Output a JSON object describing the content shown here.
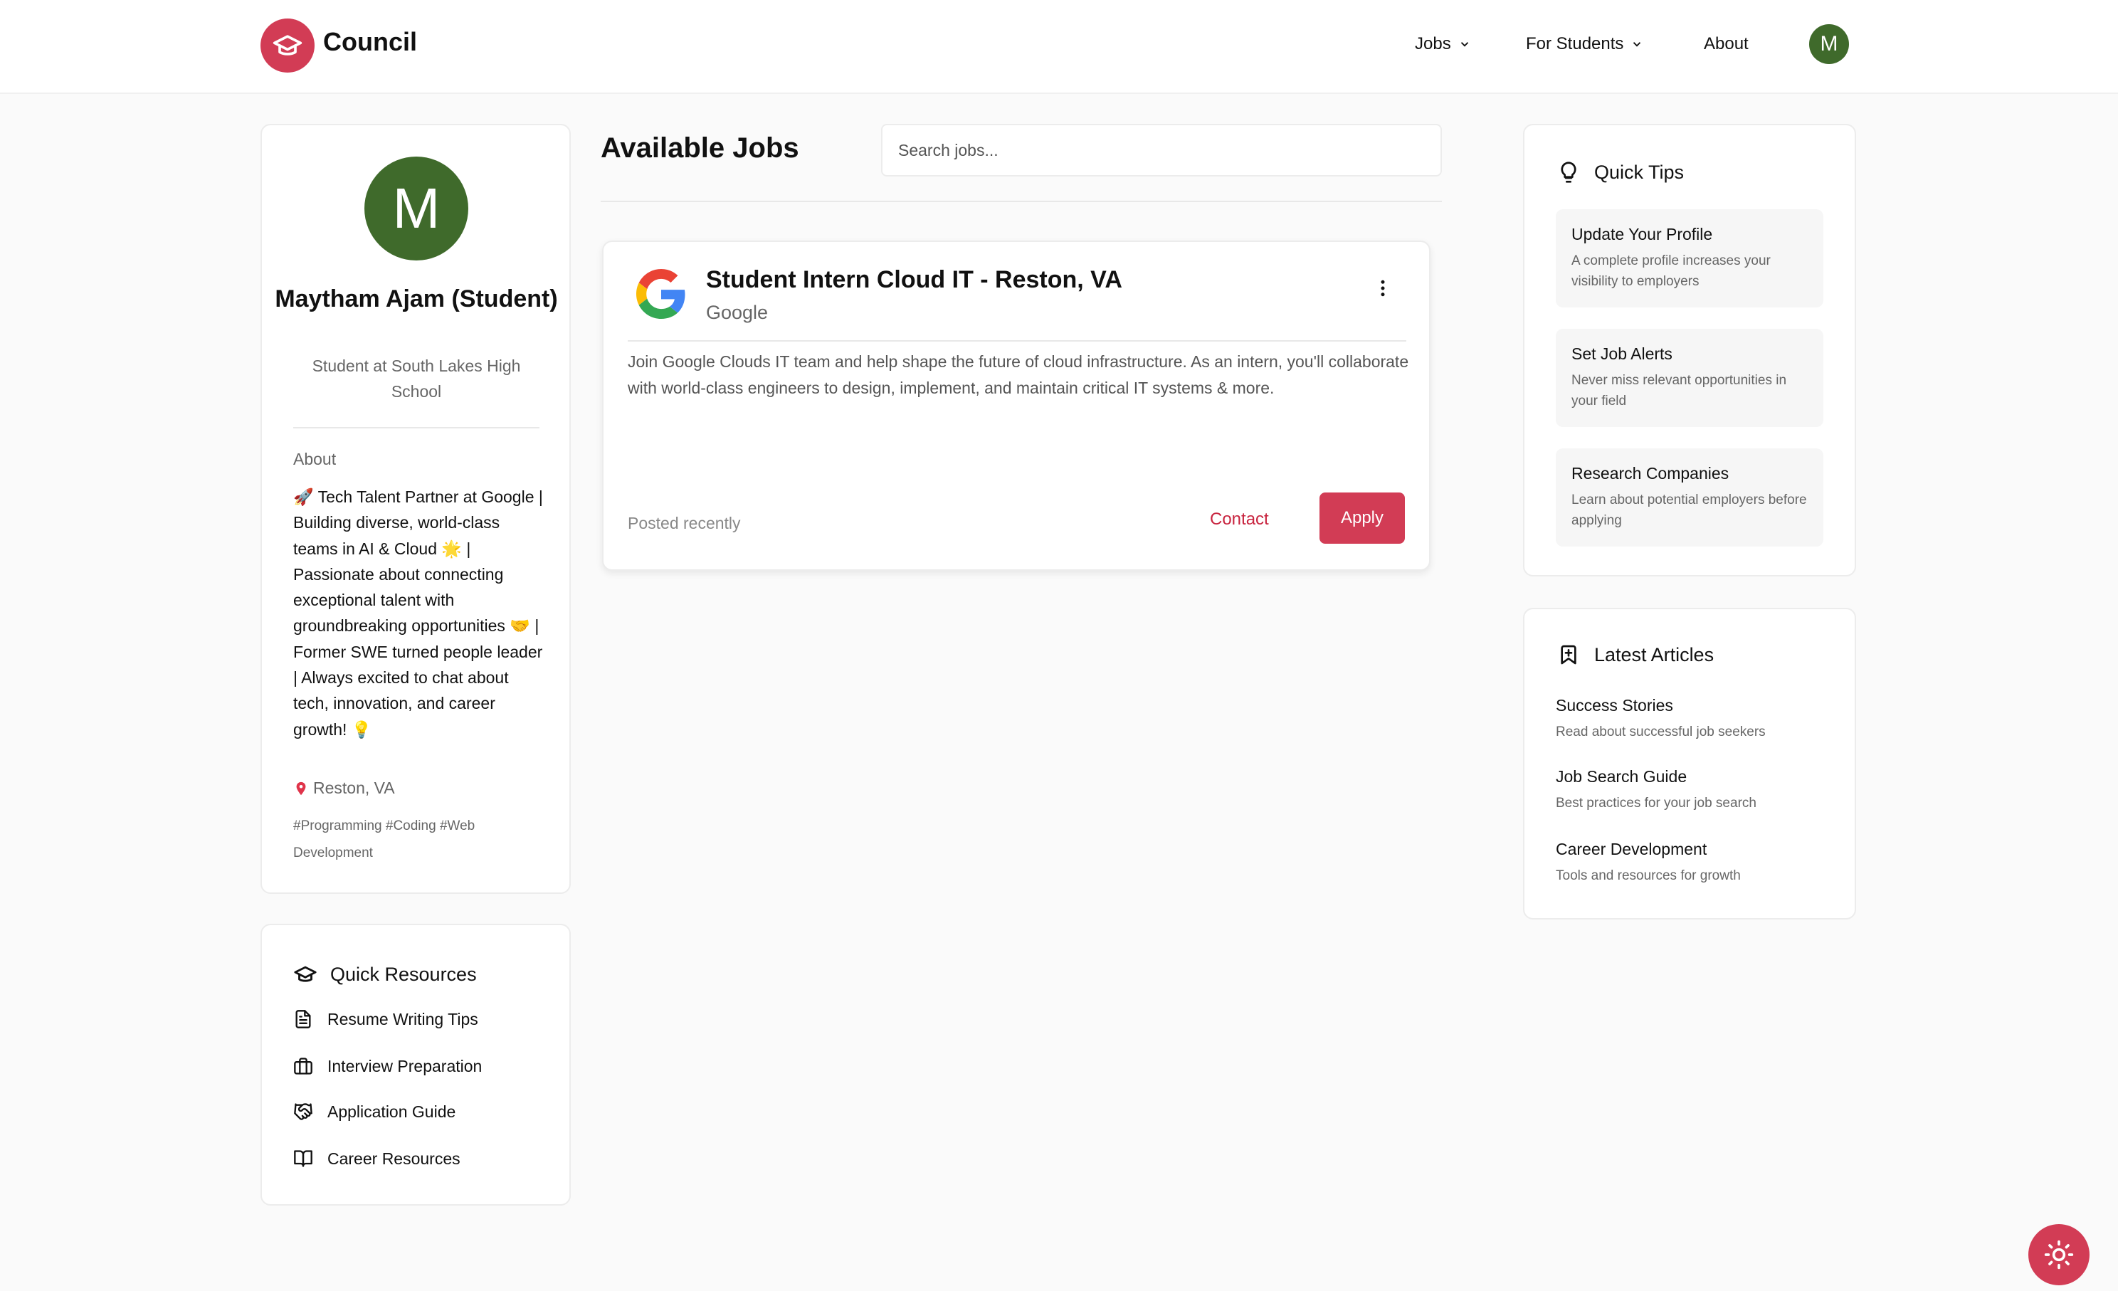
{
  "nav": {
    "brand": "Council",
    "jobs": "Jobs",
    "for_students": "For Students",
    "about": "About",
    "avatar_letter": "M"
  },
  "profile": {
    "avatar_letter": "M",
    "name": "Maytham Ajam (Student)",
    "subtitle": "Student at South Lakes High School",
    "about_label": "About",
    "about_text": "🚀 Tech Talent Partner at Google | Building diverse, world-class teams in AI & Cloud 🌟 | Passionate about connecting exceptional talent with groundbreaking opportunities 🤝 | Former SWE turned people leader | Always excited to chat about tech, innovation, and career growth! 💡",
    "location": "Reston, VA",
    "tags": "#Programming #Coding #Web Development"
  },
  "resources": {
    "title": "Quick Resources",
    "items": [
      {
        "label": "Resume Writing Tips",
        "icon": "document-icon"
      },
      {
        "label": "Interview Preparation",
        "icon": "briefcase-icon"
      },
      {
        "label": "Application Guide",
        "icon": "handshake-icon"
      },
      {
        "label": "Career Resources",
        "icon": "book-icon"
      }
    ]
  },
  "main": {
    "title": "Available Jobs",
    "search_placeholder": "Search jobs..."
  },
  "job": {
    "title": "Student Intern Cloud IT - Reston, VA",
    "company": "Google",
    "description": "Join Google Clouds IT team and help shape the future of cloud infrastructure. As an intern, you'll collaborate with world-class engineers to design, implement, and maintain critical IT systems & more.",
    "posted": "Posted recently",
    "contact_label": "Contact",
    "apply_label": "Apply"
  },
  "tips": {
    "title": "Quick Tips",
    "items": [
      {
        "title": "Update Your Profile",
        "desc": "A complete profile increases your visibility to employers"
      },
      {
        "title": "Set Job Alerts",
        "desc": "Never miss relevant opportunities in your field"
      },
      {
        "title": "Research Companies",
        "desc": "Learn about potential employers before applying"
      }
    ]
  },
  "articles": {
    "title": "Latest Articles",
    "items": [
      {
        "title": "Success Stories",
        "desc": "Read about successful job seekers"
      },
      {
        "title": "Job Search Guide",
        "desc": "Best practices for your job search"
      },
      {
        "title": "Career Development",
        "desc": "Tools and resources for growth"
      }
    ]
  },
  "colors": {
    "accent": "#d23c55",
    "avatar": "#3f6a2b"
  }
}
